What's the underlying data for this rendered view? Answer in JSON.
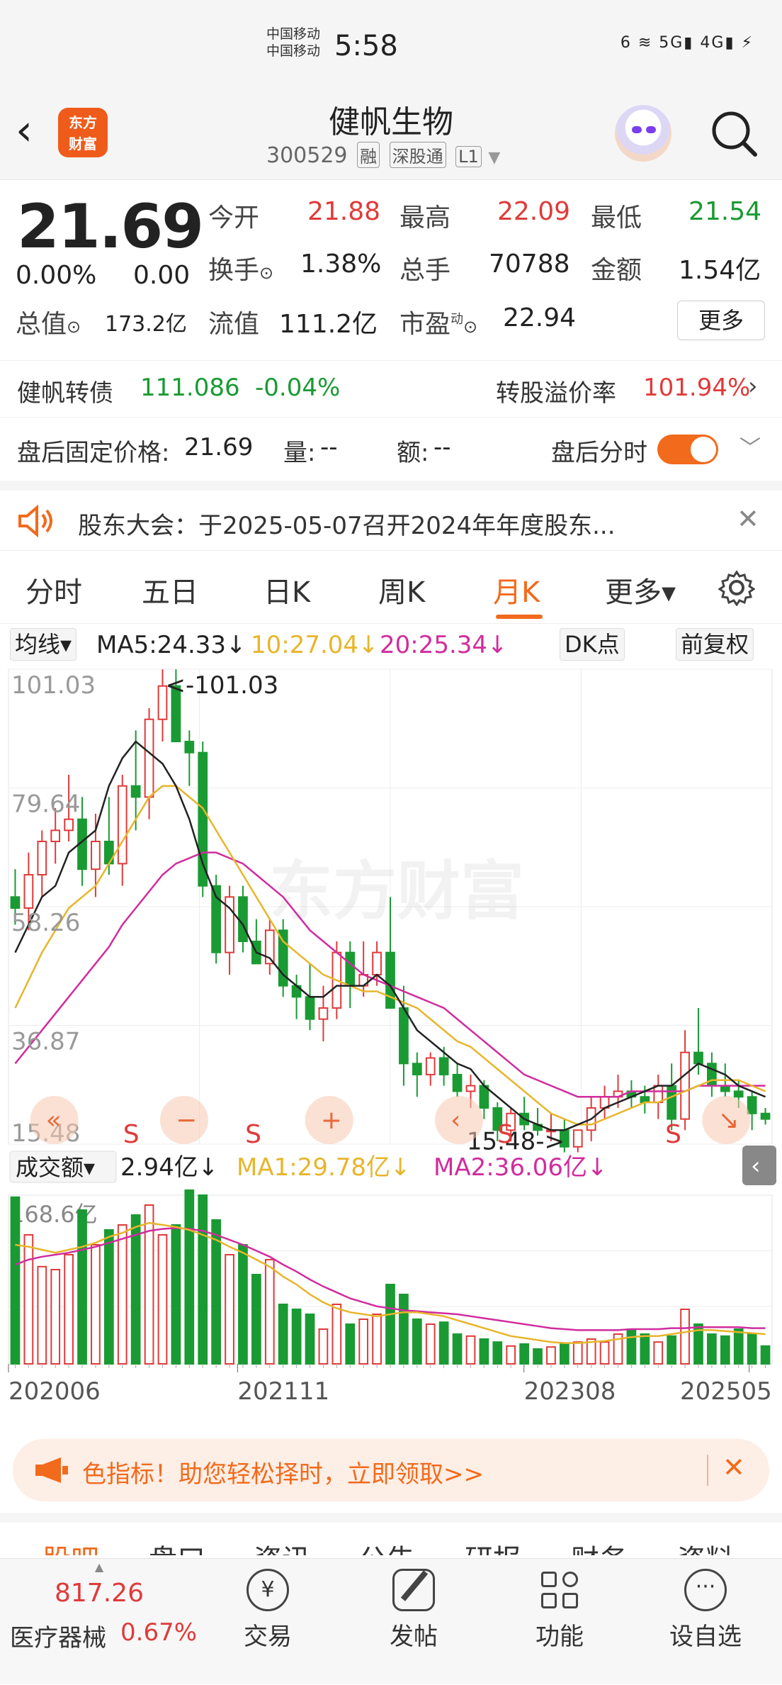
{
  "status_bar": {
    "carrier1": "中国移动",
    "carrier2": "中国移动",
    "time": "5:58",
    "icons": "6 ≋ 5G▮ 4G▮ ⚡"
  },
  "header": {
    "logo_line1": "东方",
    "logo_line2": "财富",
    "stock_name": "健帆生物",
    "stock_code": "300529",
    "tags": [
      "融",
      "深股通",
      "L1"
    ]
  },
  "quote": {
    "price": "21.69",
    "change_pct": "0.00%",
    "change": "0.00",
    "open_label": "今开",
    "open": "21.88",
    "high_label": "最高",
    "high": "22.09",
    "low_label": "最低",
    "low": "21.54",
    "turnover_label": "换手",
    "turnover": "1.38%",
    "volume_label": "总手",
    "volume": "70788",
    "amount_label": "金额",
    "amount": "1.54亿",
    "mktcap_label": "总值",
    "mktcap": "173.2亿",
    "float_label": "流值",
    "float": "111.2亿",
    "pe_label": "市盈",
    "pe_sup": "动",
    "pe": "22.94",
    "more": "更多"
  },
  "bond": {
    "name": "健帆转债",
    "price": "111.086",
    "change": "-0.04%",
    "premium_label": "转股溢价率",
    "premium": "101.94%"
  },
  "after_hours": {
    "price_label": "盘后固定价格:",
    "price": "21.69",
    "vol_label": "量:",
    "vol": "--",
    "amt_label": "额:",
    "amt": "--",
    "toggle_label": "盘后分时"
  },
  "notice": {
    "text": "股东大会：于2025-05-07召开2024年年度股东..."
  },
  "tabs": [
    "分时",
    "五日",
    "日K",
    "周K",
    "月K",
    "更多▾"
  ],
  "active_tab": "月K",
  "ma_row": {
    "indicator": "均线▾",
    "ma5": "MA5:24.33↓",
    "ma10": "10:27.04↓",
    "ma20": "20:25.34↓",
    "dk": "DK点",
    "fq": "前复权"
  },
  "colors": {
    "up": "#e03a3a",
    "down": "#1a9a33",
    "ma5": "#222222",
    "ma10": "#e8b52a",
    "ma20": "#d12c9e",
    "accent": "#f26a1b"
  },
  "chart_data": {
    "type": "candlestick",
    "y_ticks": [
      "101.03",
      "79.64",
      "58.26",
      "36.87",
      "15.48"
    ],
    "ylim": [
      15.48,
      101.03
    ],
    "max_label": "<-101.03",
    "min_label": "15.48->",
    "x_ticks": [
      "202006",
      "202111",
      "202308",
      "202505"
    ],
    "candles": [
      [
        60,
        65,
        55,
        58
      ],
      [
        58,
        68,
        54,
        64
      ],
      [
        64,
        72,
        60,
        70
      ],
      [
        70,
        76,
        66,
        72
      ],
      [
        72,
        82,
        70,
        74
      ],
      [
        74,
        78,
        62,
        65
      ],
      [
        65,
        75,
        60,
        70
      ],
      [
        70,
        78,
        64,
        66
      ],
      [
        66,
        82,
        62,
        80
      ],
      [
        80,
        90,
        72,
        78
      ],
      [
        78,
        94,
        74,
        92
      ],
      [
        92,
        101,
        88,
        98
      ],
      [
        98,
        101,
        88,
        88
      ],
      [
        88,
        90,
        80,
        86
      ],
      [
        86,
        88,
        60,
        62
      ],
      [
        62,
        64,
        48,
        50
      ],
      [
        50,
        62,
        46,
        60
      ],
      [
        60,
        62,
        50,
        52
      ],
      [
        52,
        56,
        48,
        48
      ],
      [
        48,
        56,
        46,
        54
      ],
      [
        54,
        56,
        42,
        44
      ],
      [
        44,
        46,
        38,
        42
      ],
      [
        42,
        48,
        36,
        38
      ],
      [
        38,
        44,
        34,
        40
      ],
      [
        40,
        52,
        38,
        50
      ],
      [
        50,
        52,
        40,
        44
      ],
      [
        44,
        52,
        42,
        46
      ],
      [
        46,
        52,
        44,
        50
      ],
      [
        50,
        60,
        40,
        40
      ],
      [
        40,
        44,
        26,
        30
      ],
      [
        30,
        32,
        24,
        28
      ],
      [
        28,
        32,
        26,
        31
      ],
      [
        31,
        33,
        26,
        28
      ],
      [
        28,
        30,
        24,
        25
      ],
      [
        25,
        28,
        22,
        26
      ],
      [
        26,
        27,
        20,
        22
      ],
      [
        22,
        23,
        16,
        18
      ],
      [
        18,
        22,
        16,
        21
      ],
      [
        21,
        24,
        18,
        19
      ],
      [
        19,
        22,
        17,
        18
      ],
      [
        18,
        21,
        16,
        18
      ],
      [
        18,
        20,
        14,
        15
      ],
      [
        15,
        18,
        14,
        18
      ],
      [
        18,
        24,
        16,
        22
      ],
      [
        22,
        26,
        20,
        24
      ],
      [
        24,
        28,
        22,
        25
      ],
      [
        25,
        27,
        22,
        24
      ],
      [
        24,
        26,
        21,
        23
      ],
      [
        23,
        28,
        20,
        26
      ],
      [
        26,
        30,
        18,
        20
      ],
      [
        20,
        36,
        18,
        32
      ],
      [
        32,
        40,
        28,
        30
      ],
      [
        30,
        32,
        24,
        26
      ],
      [
        26,
        30,
        24,
        25
      ],
      [
        25,
        27,
        22,
        24
      ],
      [
        24,
        25,
        18,
        21
      ],
      [
        21,
        22,
        19,
        20
      ]
    ],
    "ma5": [
      50,
      55,
      60,
      62,
      68,
      70,
      72,
      80,
      85,
      88,
      86,
      84,
      80,
      74,
      66,
      60,
      58,
      55,
      50,
      49,
      46,
      44,
      42,
      42,
      44,
      44,
      44,
      46,
      44,
      40,
      36,
      34,
      32,
      30,
      29,
      26,
      24,
      22,
      20,
      19,
      18,
      18,
      19,
      20,
      22,
      23,
      24,
      25,
      26,
      26,
      28,
      30,
      29,
      28,
      26,
      25,
      24
    ],
    "ma10": [
      40,
      45,
      50,
      54,
      58,
      60,
      62,
      66,
      70,
      74,
      78,
      80,
      80,
      78,
      76,
      72,
      68,
      64,
      60,
      56,
      52,
      50,
      48,
      46,
      45,
      44,
      43,
      43,
      42,
      41,
      40,
      38,
      36,
      34,
      33,
      31,
      29,
      27,
      25,
      23,
      21,
      20,
      19,
      19,
      20,
      21,
      22,
      23,
      23,
      24,
      25,
      26,
      27,
      27,
      27,
      26,
      25
    ],
    "ma20": [
      30,
      33,
      36,
      39,
      42,
      45,
      48,
      51,
      55,
      58,
      61,
      64,
      66,
      67,
      68,
      68,
      67,
      66,
      64,
      62,
      60,
      57,
      54,
      52,
      50,
      48,
      46,
      45,
      44,
      43,
      42,
      41,
      40,
      38,
      36,
      34,
      32,
      30,
      28,
      27,
      26,
      25,
      24,
      24,
      24,
      24,
      25,
      25,
      25,
      25,
      25,
      26,
      26,
      26,
      26,
      26,
      26
    ],
    "volume_label": "成交额▾",
    "volume_value": "2.94亿↓",
    "vol_ma1": "MA1:29.78亿↓",
    "vol_ma2": "MA2:36.06亿↓",
    "volume_max_label": "168.6亿",
    "volumes": [
      168,
      130,
      98,
      95,
      110,
      155,
      120,
      135,
      140,
      150,
      160,
      130,
      140,
      175,
      170,
      145,
      110,
      120,
      90,
      105,
      60,
      55,
      50,
      35,
      60,
      40,
      45,
      50,
      80,
      70,
      45,
      40,
      42,
      30,
      28,
      25,
      22,
      18,
      20,
      15,
      17,
      20,
      22,
      25,
      22,
      30,
      35,
      30,
      22,
      28,
      55,
      40,
      30,
      28,
      35,
      30,
      18
    ],
    "vol_ma1_line": [
      120,
      118,
      115,
      112,
      115,
      118,
      122,
      128,
      132,
      138,
      142,
      140,
      138,
      135,
      130,
      125,
      118,
      112,
      105,
      98,
      88,
      80,
      70,
      62,
      56,
      52,
      50,
      48,
      50,
      52,
      52,
      50,
      48,
      44,
      40,
      36,
      32,
      28,
      26,
      24,
      22,
      21,
      21,
      22,
      23,
      25,
      27,
      28,
      28,
      30,
      32,
      34,
      34,
      33,
      32,
      31,
      30
    ],
    "vol_ma2_line": [
      100,
      105,
      108,
      110,
      112,
      115,
      118,
      122,
      126,
      130,
      134,
      136,
      137,
      136,
      134,
      130,
      125,
      120,
      114,
      108,
      100,
      93,
      85,
      78,
      72,
      66,
      62,
      58,
      56,
      54,
      53,
      52,
      51,
      50,
      48,
      46,
      44,
      42,
      40,
      38,
      36,
      35,
      34,
      34,
      34,
      34,
      35,
      35,
      35,
      36,
      36,
      37,
      37,
      37,
      37,
      36,
      36
    ]
  },
  "watermark": "东方财富",
  "banner": {
    "text": "色指标！助您轻松择时，立即领取>>"
  },
  "subtabs": [
    "股吧",
    "盘口",
    "资讯",
    "公告",
    "研报",
    "财务",
    "资料"
  ],
  "bottom_nav": {
    "index_value": "817.26",
    "index_name": "医疗器械",
    "index_change": "0.67%",
    "items": [
      "交易",
      "发帖",
      "功能",
      "设自选"
    ]
  }
}
